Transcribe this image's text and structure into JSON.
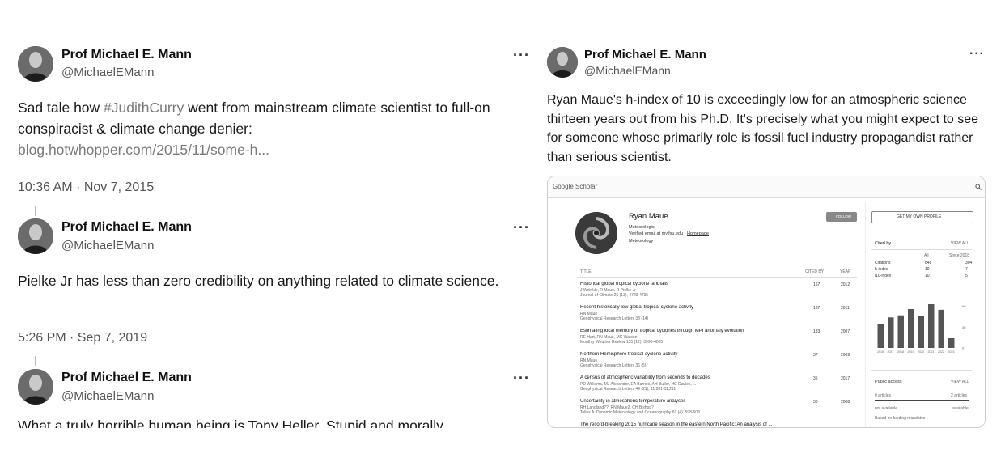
{
  "tweets_left": [
    {
      "name": "Prof Michael E. Mann",
      "handle": "@MichaelEMann",
      "text_before": "Sad tale how ",
      "hashtag": "#JudithCurry",
      "text_after": " went from mainstream climate scientist to full-on conspiracist & climate change denier:",
      "link": "blog.hotwhopper.com/2015/11/some-h...",
      "timestamp": "10:36 AM · Nov 7, 2015"
    },
    {
      "name": "Prof Michael E. Mann",
      "handle": "@MichaelEMann",
      "text": "Pielke Jr has less than zero credibility on anything related to climate science.",
      "timestamp": "5:26 PM · Sep 7, 2019"
    },
    {
      "name": "Prof Michael E. Mann",
      "handle": "@MichaelEMann",
      "text": "What a truly horrible human being is Tony Heller. Stupid and morally"
    }
  ],
  "tweet_right": {
    "name": "Prof Michael E. Mann",
    "handle": "@MichaelEMann",
    "text": "Ryan Maue's h-index of 10 is exceedingly low for an atmospheric science thirteen years out from his Ph.D.  It's precisely what you might expect to see for someone whose primarily role is fossil fuel industry propagandist rather than serious scientist."
  },
  "more_icon": "···",
  "scholar": {
    "brand": "Google Scholar",
    "profile_name": "Ryan Maue",
    "profile_role": "Meteorologist",
    "profile_email": "Verified email at my.fsu.edu - ",
    "profile_homepage": "Homepage",
    "profile_interest": "Meteorology",
    "follow": "FOLLOW",
    "get_profile": "GET MY OWN PROFILE",
    "col_title": "TITLE",
    "col_cited": "CITED BY",
    "col_year": "YEAR",
    "articles": [
      {
        "title": "Historical global tropical cyclone landfalls",
        "authors": "J Weinkle, R Maue, R Pielke Jr",
        "venue": "Journal of Climate 25 (13), 4729-4735",
        "cited": "167",
        "year": "2012"
      },
      {
        "title": "Recent historically low global tropical cyclone activity",
        "authors": "RN Maue",
        "venue": "Geophysical Research Letters 38 (14)",
        "cited": "137",
        "year": "2011"
      },
      {
        "title": "Estimating local memory of tropical cyclones through MPI anomaly evolution",
        "authors": "RE Hart, RN Maue, MC Watson",
        "venue": "Monthly Weather Review 135 (12), 3990-4005",
        "cited": "133",
        "year": "2007"
      },
      {
        "title": "Northern Hemisphere tropical cyclone activity",
        "authors": "RN Maue",
        "venue": "Geophysical Research Letters 36 (5)",
        "cited": "37",
        "year": "2009"
      },
      {
        "title": "A census of atmospheric variability from seconds to decades",
        "authors": "PD Williams, MJ Alexander, EA Barnes, AH Butler, HC Davies, ...",
        "venue": "Geophysical Research Letters 44 (21), 11,201-11,211",
        "cited": "35",
        "year": "2017"
      },
      {
        "title": "Uncertainty in atmospheric temperature analyses",
        "authors": "RH Langland??, RN Maue2, CH Bishop?",
        "venue": "Tellus A: Dynamic Meteorology and Oceanography 60 (4), 598-603",
        "cited": "30",
        "year": "2008"
      },
      {
        "title": "The record-breaking 2015 hurricane season in the eastern North Pacific: An analysis of ...",
        "authors": "",
        "venue": "",
        "cited": "",
        "year": ""
      }
    ],
    "cited_by": "Cited by",
    "view_all": "VIEW ALL",
    "stats_header": [
      "",
      "All",
      "Since 2018"
    ],
    "stats": [
      [
        "Citations",
        "848",
        "304"
      ],
      [
        "h-index",
        "10",
        "7"
      ],
      [
        "i10-index",
        "10",
        "5"
      ]
    ],
    "chart_data": {
      "type": "bar",
      "categories": [
        "2016",
        "2017",
        "2018",
        "2019",
        "2020",
        "2021",
        "2022",
        "2023"
      ],
      "values": [
        34,
        44,
        47,
        56,
        46,
        63,
        55,
        14
      ],
      "yticks": [
        "60",
        "30",
        "0"
      ],
      "ylim": [
        0,
        70
      ]
    },
    "public_access": "Public access",
    "pa_view_all": "VIEW ALL",
    "pa_left": "0 articles",
    "pa_right": "2 articles",
    "pa_not": "not available",
    "pa_avail": "available",
    "pa_note": "Based on funding mandates"
  }
}
